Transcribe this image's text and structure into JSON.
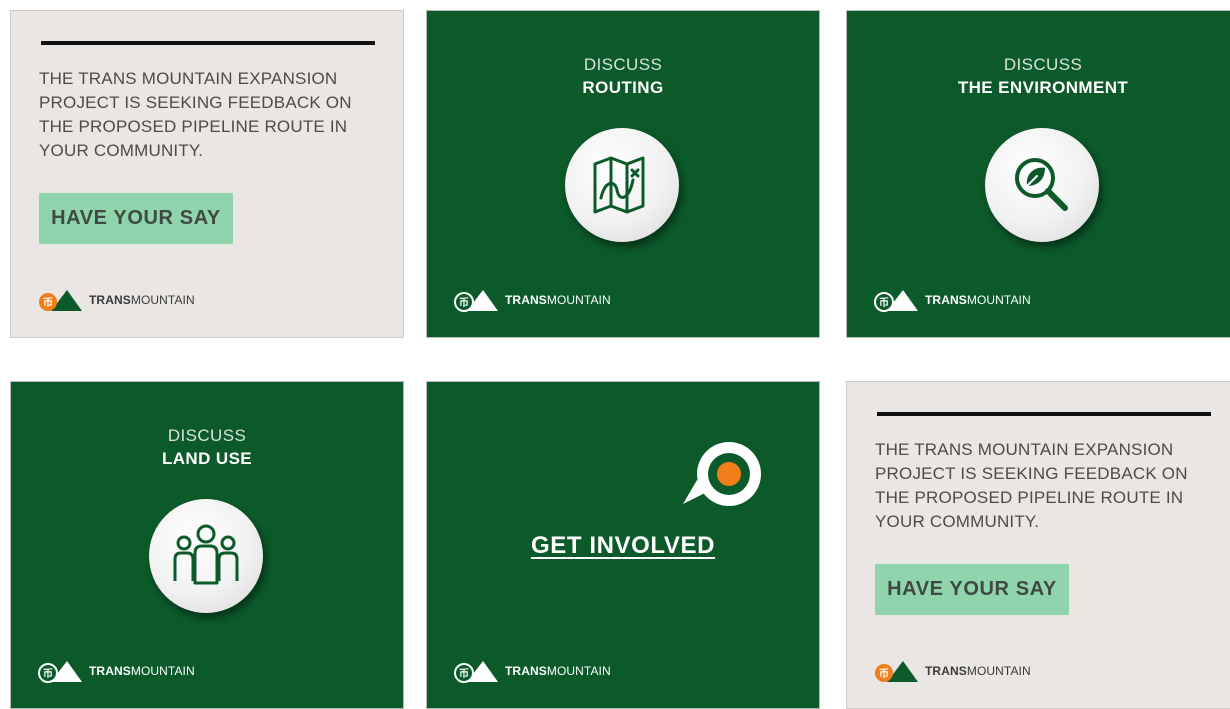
{
  "brand": {
    "name_bold": "TRANS",
    "name_regular": "MOUNTAIN",
    "logo_glyph": "币"
  },
  "colors": {
    "green": "#0c5a2a",
    "light": "#e9e6e3",
    "cta": "#8fd4ab",
    "orange": "#f07e1b"
  },
  "cards": {
    "intro_1": {
      "message": "THE TRANS MOUNTAIN EXPANSION PROJECT IS SEEKING FEEDBACK ON THE PROPOSED PIPELINE ROUTE IN YOUR COMMUNITY.",
      "cta": "HAVE YOUR SAY"
    },
    "routing": {
      "kicker": "DISCUSS",
      "headline": "ROUTING",
      "icon": "map-icon"
    },
    "environment": {
      "kicker": "DISCUSS",
      "headline": "THE ENVIRONMENT",
      "icon": "leaf-magnifier-icon"
    },
    "land_use": {
      "kicker": "DISCUSS",
      "headline": "LAND USE",
      "icon": "people-group-icon"
    },
    "get_involved": {
      "cta": "GET INVOLVED",
      "icon": "speech-bubble-icon"
    },
    "intro_2": {
      "message": "THE TRANS MOUNTAIN EXPANSION PROJECT IS SEEKING FEEDBACK ON THE PROPOSED PIPELINE ROUTE IN YOUR COMMUNITY.",
      "cta": "HAVE YOUR SAY"
    }
  }
}
